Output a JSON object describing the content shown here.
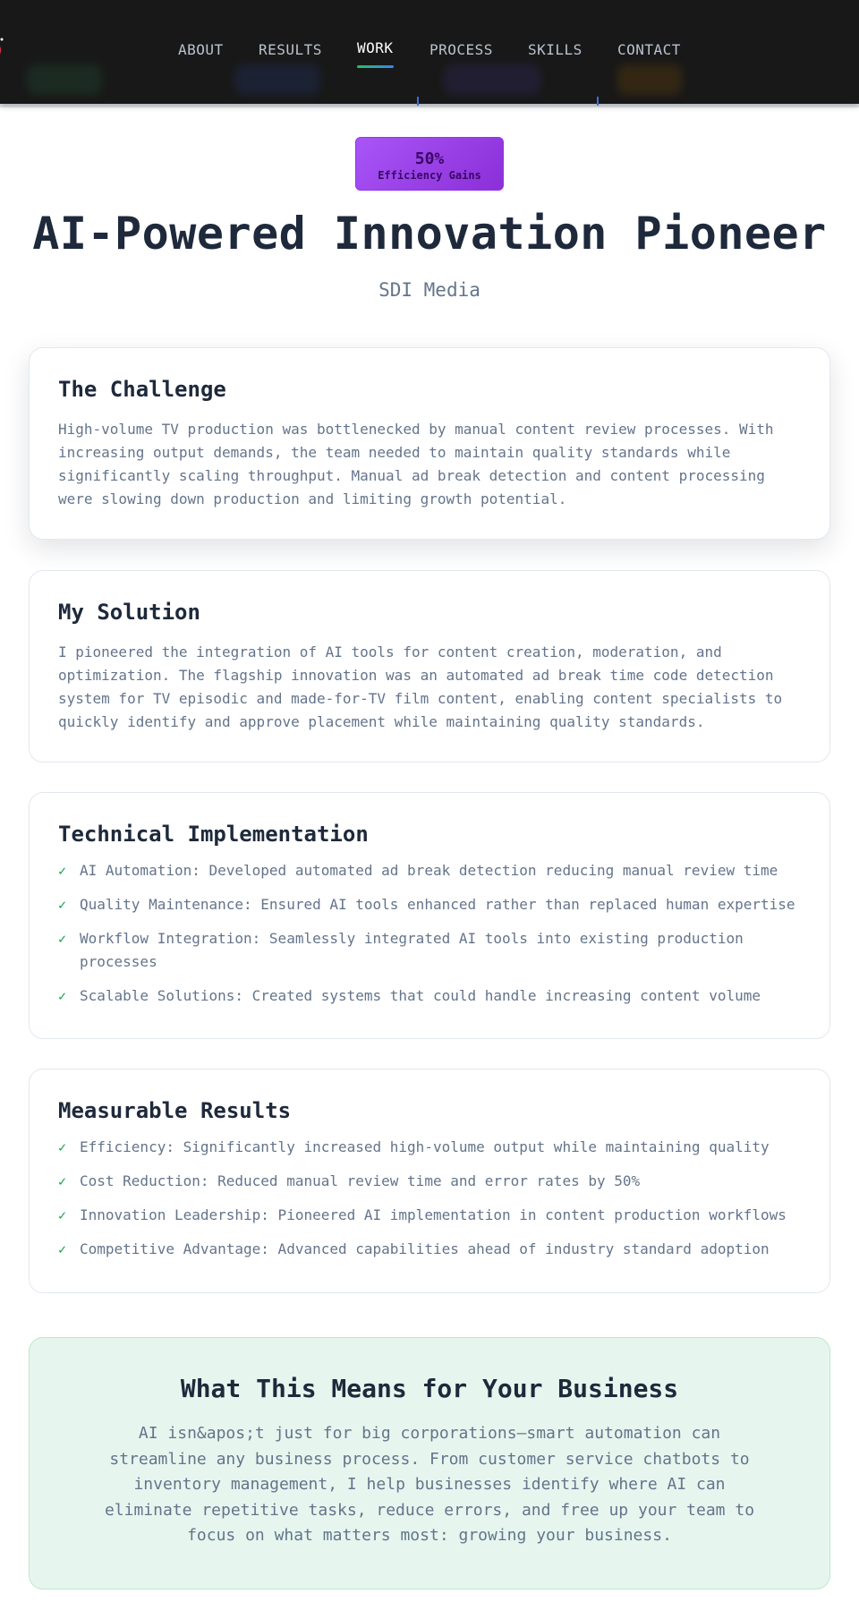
{
  "nav": {
    "links": [
      "ABOUT",
      "RESULTS",
      "WORK",
      "PROCESS",
      "SKILLS",
      "CONTACT"
    ],
    "active": "WORK",
    "accent_colors": [
      "#22c55e",
      "#3b82f6"
    ]
  },
  "badge": {
    "value": "50%",
    "label": "Efficiency Gains",
    "color": "#a855f7"
  },
  "header": {
    "title": "AI-Powered Innovation Pioneer",
    "subtitle": "SDI Media"
  },
  "challenge": {
    "title": "The Challenge",
    "text": "High-volume TV production was bottlenecked by manual content review processes. With increasing output demands, the team needed to maintain quality standards while significantly scaling throughput. Manual ad break detection and content processing were slowing down production and limiting growth potential."
  },
  "solution": {
    "title": "My Solution",
    "text": "I pioneered the integration of AI tools for content creation, moderation, and optimization. The flagship innovation was an automated ad break time code detection system for TV episodic and made-for-TV film content, enabling content specialists to quickly identify and approve placement while maintaining quality standards."
  },
  "technical": {
    "title": "Technical Implementation",
    "items": [
      "AI Automation: Developed automated ad break detection reducing manual review time",
      "Quality Maintenance: Ensured AI tools enhanced rather than replaced human expertise",
      "Workflow Integration: Seamlessly integrated AI tools into existing production processes",
      "Scalable Solutions: Created systems that could handle increasing content volume"
    ]
  },
  "results": {
    "title": "Measurable Results",
    "items": [
      "Efficiency: Significantly increased high-volume output while maintaining quality",
      "Cost Reduction: Reduced manual review time and error rates by 50%",
      "Innovation Leadership: Pioneered AI implementation in content production workflows",
      "Competitive Advantage: Advanced capabilities ahead of industry standard adoption"
    ]
  },
  "check_icon": "✓",
  "cta": {
    "title": "What This Means for Your Business",
    "text": "AI isn&apos;t just for big corporations—smart automation can streamline any business process. From customer service chatbots to inventory management, I help businesses identify where AI can eliminate repetitive tasks, reduce errors, and free up your team to focus on what matters most: growing your business."
  }
}
